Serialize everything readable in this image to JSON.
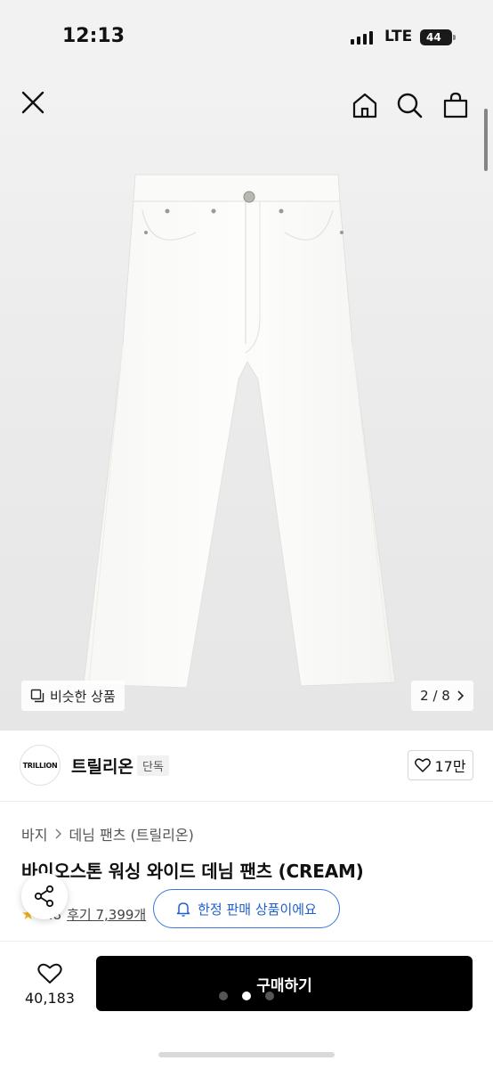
{
  "status_bar": {
    "time": "12:13",
    "network": "LTE",
    "battery": "44"
  },
  "top_nav": {
    "icons": [
      "close-icon",
      "home-icon",
      "search-icon",
      "bag-icon"
    ]
  },
  "image_gallery": {
    "similar_label": "비슷한 상품",
    "page_current": "2",
    "page_total": "8",
    "page_text": "2 / 8"
  },
  "brand": {
    "logo_text": "TRILLION",
    "name": "트릴리온",
    "badge": "단독",
    "like_count": "17만"
  },
  "product": {
    "breadcrumb": [
      "바지",
      "데님 팬츠 (트릴리온)"
    ],
    "title": "바이오스톤 워싱 와이드 데님 팬츠 (CREAM)",
    "rating": "4.8",
    "review_text": "후기 7,399개"
  },
  "tooltip": {
    "limited_text": "한정 판매 상품이에요"
  },
  "bottom_bar": {
    "wish_count": "40,183",
    "buy_label": "구매하기"
  },
  "colors": {
    "accent_blue": "#1f5fc9",
    "buy_button": "#000000",
    "star": "#f5b21a"
  }
}
